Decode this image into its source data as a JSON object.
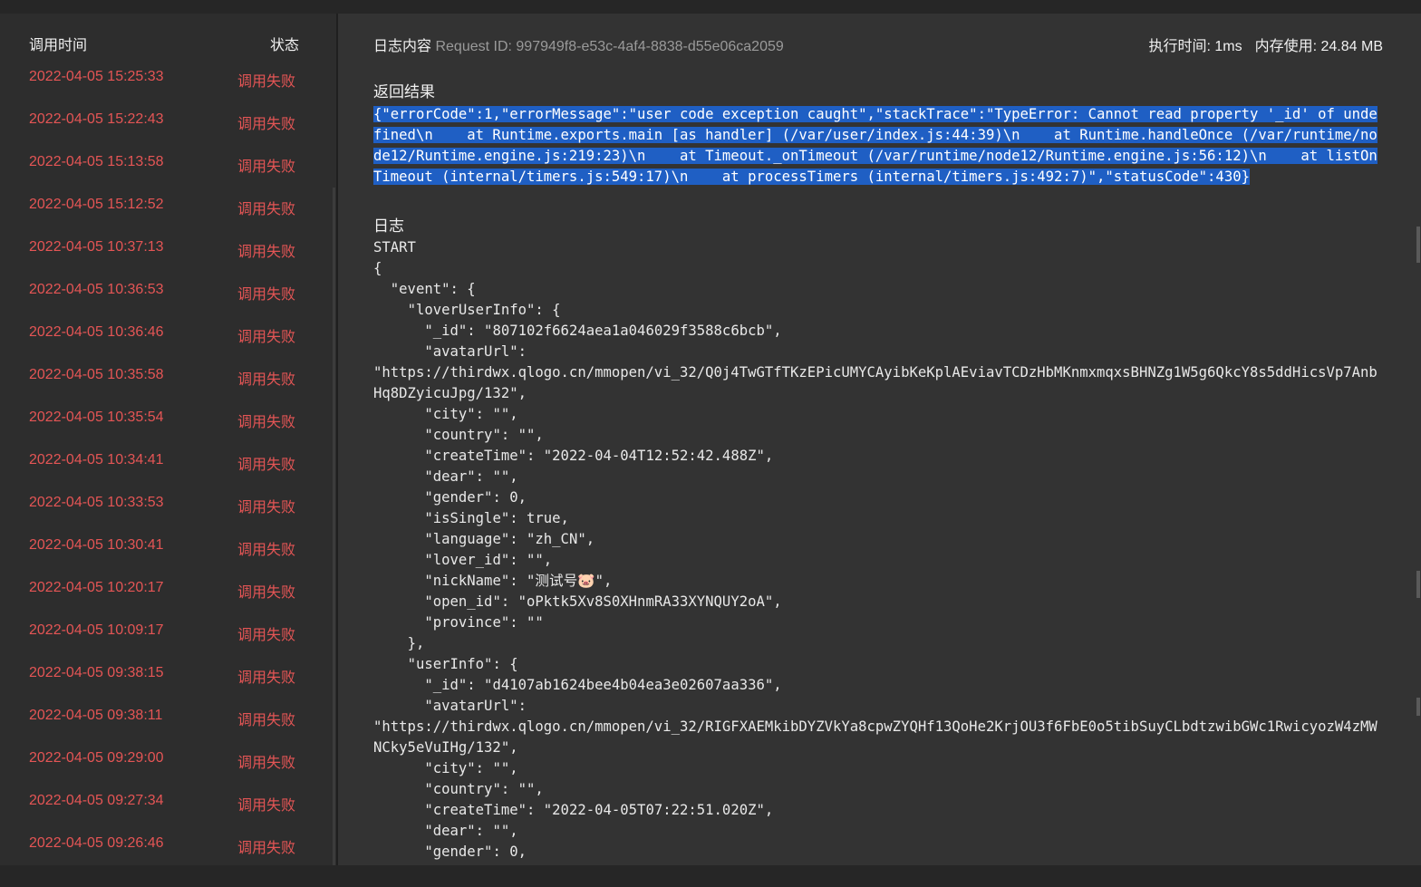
{
  "list": {
    "header": {
      "time": "调用时间",
      "status": "状态"
    },
    "rows": [
      {
        "time": "2022-04-05 15:25:33",
        "status": "调用失败"
      },
      {
        "time": "2022-04-05 15:22:43",
        "status": "调用失败"
      },
      {
        "time": "2022-04-05 15:13:58",
        "status": "调用失败"
      },
      {
        "time": "2022-04-05 15:12:52",
        "status": "调用失败"
      },
      {
        "time": "2022-04-05 10:37:13",
        "status": "调用失败"
      },
      {
        "time": "2022-04-05 10:36:53",
        "status": "调用失败"
      },
      {
        "time": "2022-04-05 10:36:46",
        "status": "调用失败"
      },
      {
        "time": "2022-04-05 10:35:58",
        "status": "调用失败"
      },
      {
        "time": "2022-04-05 10:35:54",
        "status": "调用失败"
      },
      {
        "time": "2022-04-05 10:34:41",
        "status": "调用失败"
      },
      {
        "time": "2022-04-05 10:33:53",
        "status": "调用失败"
      },
      {
        "time": "2022-04-05 10:30:41",
        "status": "调用失败"
      },
      {
        "time": "2022-04-05 10:20:17",
        "status": "调用失败"
      },
      {
        "time": "2022-04-05 10:09:17",
        "status": "调用失败"
      },
      {
        "time": "2022-04-05 09:38:15",
        "status": "调用失败"
      },
      {
        "time": "2022-04-05 09:38:11",
        "status": "调用失败"
      },
      {
        "time": "2022-04-05 09:29:00",
        "status": "调用失败"
      },
      {
        "time": "2022-04-05 09:27:34",
        "status": "调用失败"
      },
      {
        "time": "2022-04-05 09:26:46",
        "status": "调用失败"
      }
    ]
  },
  "detail": {
    "title": "日志内容",
    "request_id": "Request ID: 997949f8-e53c-4af4-8838-d55e06ca2059",
    "exec_time": "执行时间: 1ms",
    "memory": "内存使用: 24.84 MB",
    "result_title": "返回结果",
    "result": "{\"errorCode\":1,\"errorMessage\":\"user code exception caught\",\"stackTrace\":\"TypeError: Cannot read property '_id' of undefined\\n    at Runtime.exports.main [as handler] (/var/user/index.js:44:39)\\n    at Runtime.handleOnce (/var/runtime/node12/Runtime.engine.js:219:23)\\n    at Timeout._onTimeout (/var/runtime/node12/Runtime.engine.js:56:12)\\n    at listOnTimeout (internal/timers.js:549:17)\\n    at processTimers (internal/timers.js:492:7)\",\"statusCode\":430}",
    "log_title": "日志",
    "log": "START\n{\n  \"event\": {\n    \"loverUserInfo\": {\n      \"_id\": \"807102f6624aea1a046029f3588c6bcb\",\n      \"avatarUrl\":\n\"https://thirdwx.qlogo.cn/mmopen/vi_32/Q0j4TwGTfTKzEPicUMYCAyibKeKplAEviavTCDzHbMKnmxmqxsBHNZg1W5g6QkcY8s5ddHicsVp7AnbHq8DZyicuJpg/132\",\n      \"city\": \"\",\n      \"country\": \"\",\n      \"createTime\": \"2022-04-04T12:52:42.488Z\",\n      \"dear\": \"\",\n      \"gender\": 0,\n      \"isSingle\": true,\n      \"language\": \"zh_CN\",\n      \"lover_id\": \"\",\n      \"nickName\": \"测试号🐷\",\n      \"open_id\": \"oPktk5Xv8S0XHnmRA33XYNQUY2oA\",\n      \"province\": \"\"\n    },\n    \"userInfo\": {\n      \"_id\": \"d4107ab1624bee4b04ea3e02607aa336\",\n      \"avatarUrl\":\n\"https://thirdwx.qlogo.cn/mmopen/vi_32/RIGFXAEMkibDYZVkYa8cpwZYQHf13QoHe2KrjOU3f6FbE0o5tibSuyCLbdtzwibGWc1RwicyozW4zMWNCky5eVuIHg/132\",\n      \"city\": \"\",\n      \"country\": \"\",\n      \"createTime\": \"2022-04-05T07:22:51.020Z\",\n      \"dear\": \"\",\n      \"gender\": 0,"
  }
}
